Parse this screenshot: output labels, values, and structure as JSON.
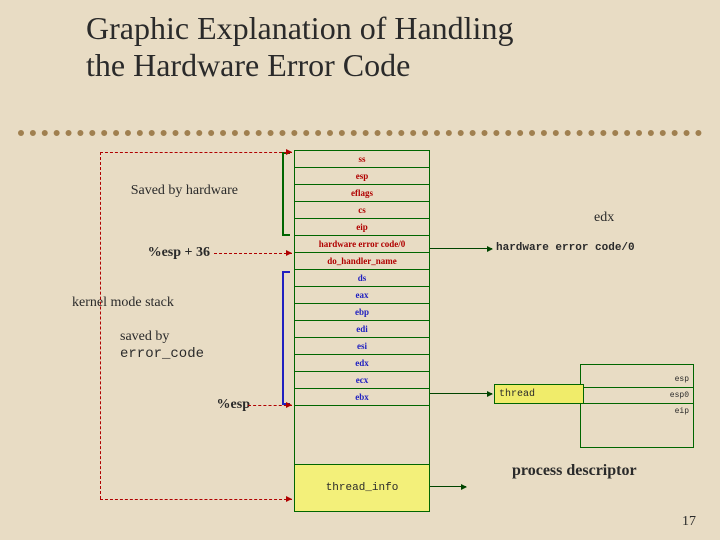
{
  "title_line1": "Graphic Explanation of Handling",
  "title_line2": "the Hardware Error Code",
  "stack": {
    "ss": "ss",
    "esp": "esp",
    "eflags": "eflags",
    "cs": "cs",
    "eip": "eip",
    "hw_err": "hardware error code/0",
    "do_handler": "do_handler_name",
    "ds": "ds",
    "eax": "eax",
    "ebp": "ebp",
    "edi": "edi",
    "esi": "esi",
    "edx": "edx",
    "ecx": "ecx",
    "ebx": "ebx"
  },
  "thread_info": "thread_info",
  "labels": {
    "saved_by_hw": "Saved by hardware",
    "esp36": "%esp + 36",
    "kms": "kernel mode stack",
    "saved_by": "saved by",
    "error_code": "error_code",
    "esp": "%esp"
  },
  "right": {
    "edx": "edx",
    "hw_code": "hardware error code/0",
    "thread": "thread",
    "esp": "esp",
    "esp0": "esp0",
    "eip": "eip",
    "pd": "process descriptor"
  },
  "page": "17"
}
